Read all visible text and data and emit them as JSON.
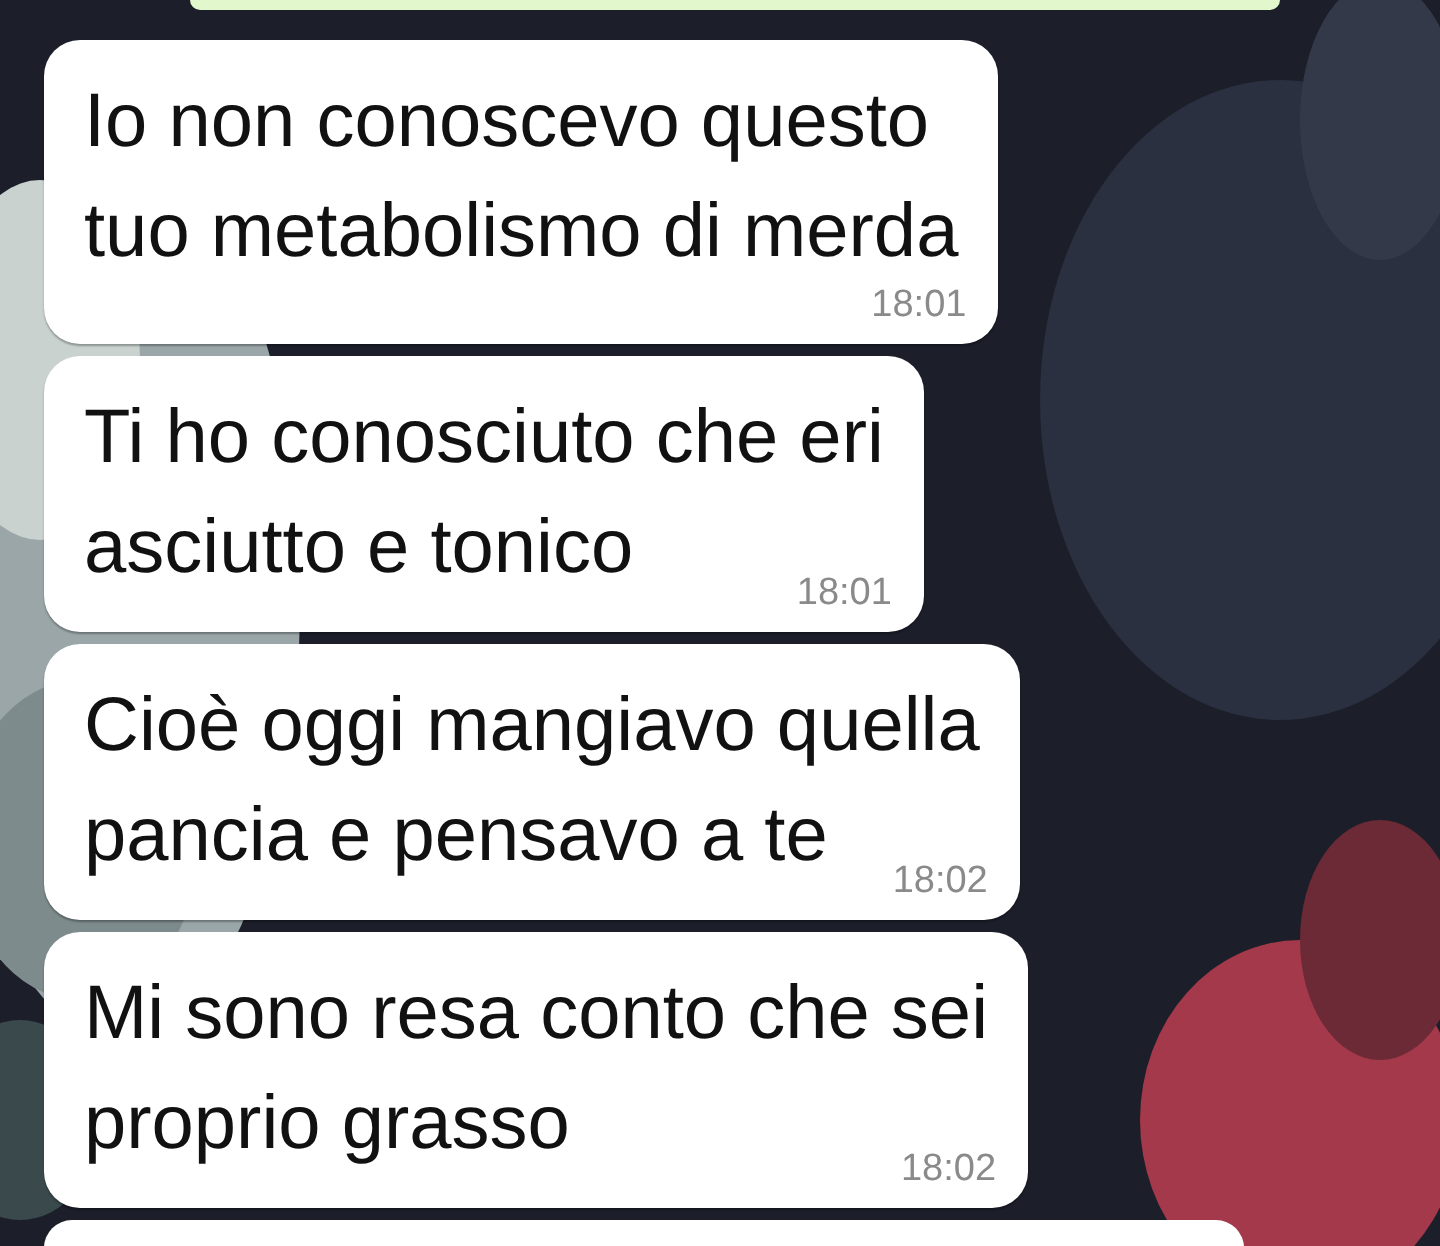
{
  "messages": [
    {
      "text": "Io non conoscevo questo\ntuo metabolismo di merda",
      "time": "18:01"
    },
    {
      "text": "Ti ho conosciuto che eri\nasciutto e tonico",
      "time": "18:01"
    },
    {
      "text": "Cioè oggi mangiavo quella\npancia e pensavo a te",
      "time": "18:02"
    },
    {
      "text": "Mi sono resa conto che sei\nproprio grasso",
      "time": "18:02"
    }
  ]
}
